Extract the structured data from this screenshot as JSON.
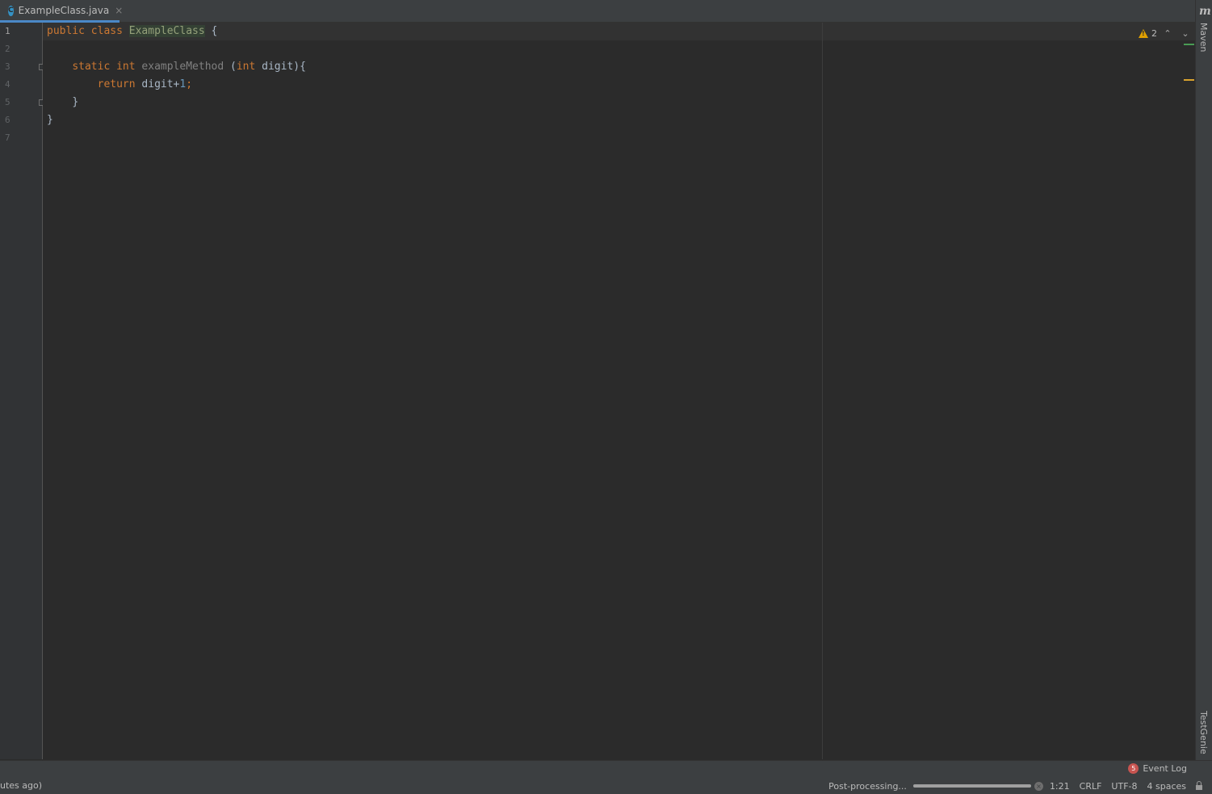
{
  "tab": {
    "file_name": "ExampleClass.java",
    "icon": "java-class-icon",
    "icon_letter": "C",
    "close_glyph": "×"
  },
  "right_strip": {
    "maven_logo": "m",
    "maven_label": "Maven",
    "testgenie_label": "TestGenie"
  },
  "gutter": {
    "line_numbers": [
      "1",
      "2",
      "3",
      "4",
      "5",
      "6",
      "7"
    ],
    "current_line": "1"
  },
  "code": {
    "line1": {
      "kw1": "public",
      "kw2": "class",
      "class_name": "ExampleClass",
      "brace": "{"
    },
    "line3": {
      "kw1": "static",
      "kw2": "int",
      "method": "exampleMethod",
      "open": "(",
      "kw3": "int",
      "param": "digit){"
    },
    "line4": {
      "kw": "return",
      "expr": "digit+",
      "num": "1",
      "semi": ";"
    },
    "line5": {
      "brace": "}"
    },
    "line6": {
      "brace": "}"
    }
  },
  "inspection": {
    "warning_count": "2",
    "up_glyph": "⌃",
    "down_glyph": "⌄"
  },
  "event_log": {
    "badge_count": "5",
    "label": "Event Log"
  },
  "status_bar": {
    "left_text": "utes ago)",
    "task": "Post-processing...",
    "progress_fraction": 1.0,
    "cursor_position": "1:21",
    "line_separator": "CRLF",
    "encoding": "UTF-8",
    "indent": "4 spaces"
  },
  "colors": {
    "editor_bg": "#2b2b2b",
    "keyword": "#cc7832",
    "number": "#6897bb",
    "text": "#a9b7c6",
    "warning": "#e0a000",
    "tab_underline": "#4a88c7"
  }
}
